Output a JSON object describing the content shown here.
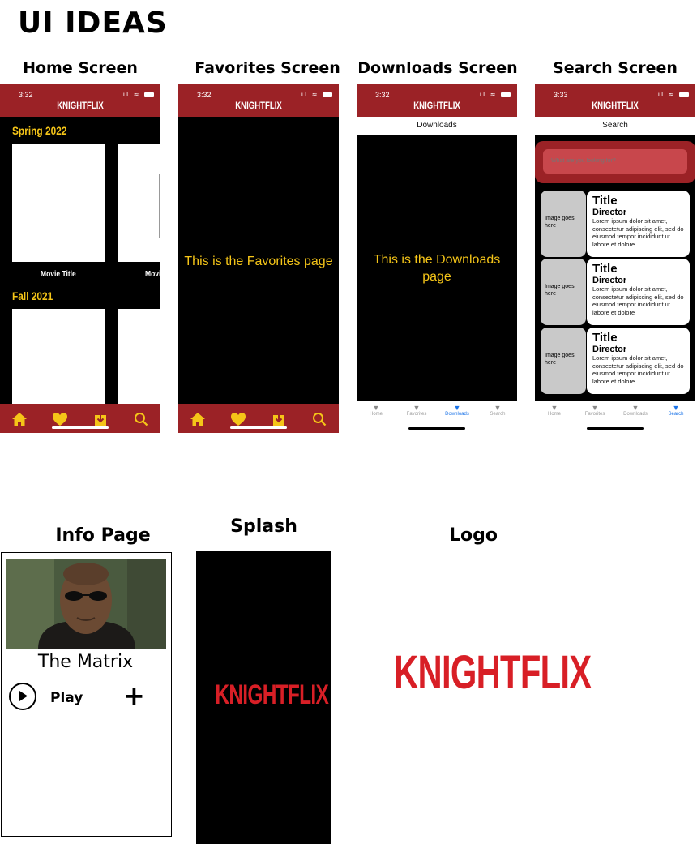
{
  "page": {
    "title": "UI IDEAS"
  },
  "sections": {
    "home": "Home Screen",
    "favorites": "Favorites Screen",
    "downloads": "Downloads Screen",
    "search": "Search Screen",
    "info": "Info Page",
    "splash": "Splash",
    "logo": "Logo"
  },
  "status": {
    "time_1": "3:32",
    "time_2": "3:33",
    "icons": "..ıl ≈"
  },
  "brand": "KNIGHTFLIX",
  "home": {
    "categories": [
      "Spring 2022",
      "Fall 2021"
    ],
    "movie_title": "Movie Title",
    "movie_title_partial": "Movi"
  },
  "favorites": {
    "message": "This is the Favorites page"
  },
  "downloads": {
    "header": "Downloads",
    "message": "This is the Downloads page"
  },
  "search": {
    "header": "Search",
    "placeholder": "What are you looking for?",
    "results": [
      {
        "image": "Image goes here",
        "title": "Title",
        "director": "Director",
        "desc": "Lorem ipsum dolor sit amet, consectetur adipiscing elit, sed do eiusmod tempor incididunt ut labore et dolore"
      },
      {
        "image": "Image goes here",
        "title": "Title",
        "director": "Director",
        "desc": "Lorem ipsum dolor sit amet, consectetur adipiscing elit, sed do eiusmod tempor incididunt ut labore et dolore"
      },
      {
        "image": "Image goes here",
        "title": "Title",
        "director": "Director",
        "desc": "Lorem ipsum dolor sit amet, consectetur adipiscing elit, sed do eiusmod tempor incididunt ut labore et dolore"
      }
    ]
  },
  "ios_tabs": [
    "Home",
    "Favorites",
    "Downloads",
    "Search"
  ],
  "info": {
    "movie_title": "The Matrix",
    "play_label": "Play",
    "add_label": "+"
  },
  "colors": {
    "brand_red": "#9b2226",
    "logo_red": "#d81f26",
    "accent_yellow": "#f5c518",
    "ios_blue": "#1a73e8"
  },
  "icons": [
    "home-icon",
    "heart-icon",
    "download-icon",
    "search-icon",
    "play-icon",
    "plus-icon"
  ]
}
